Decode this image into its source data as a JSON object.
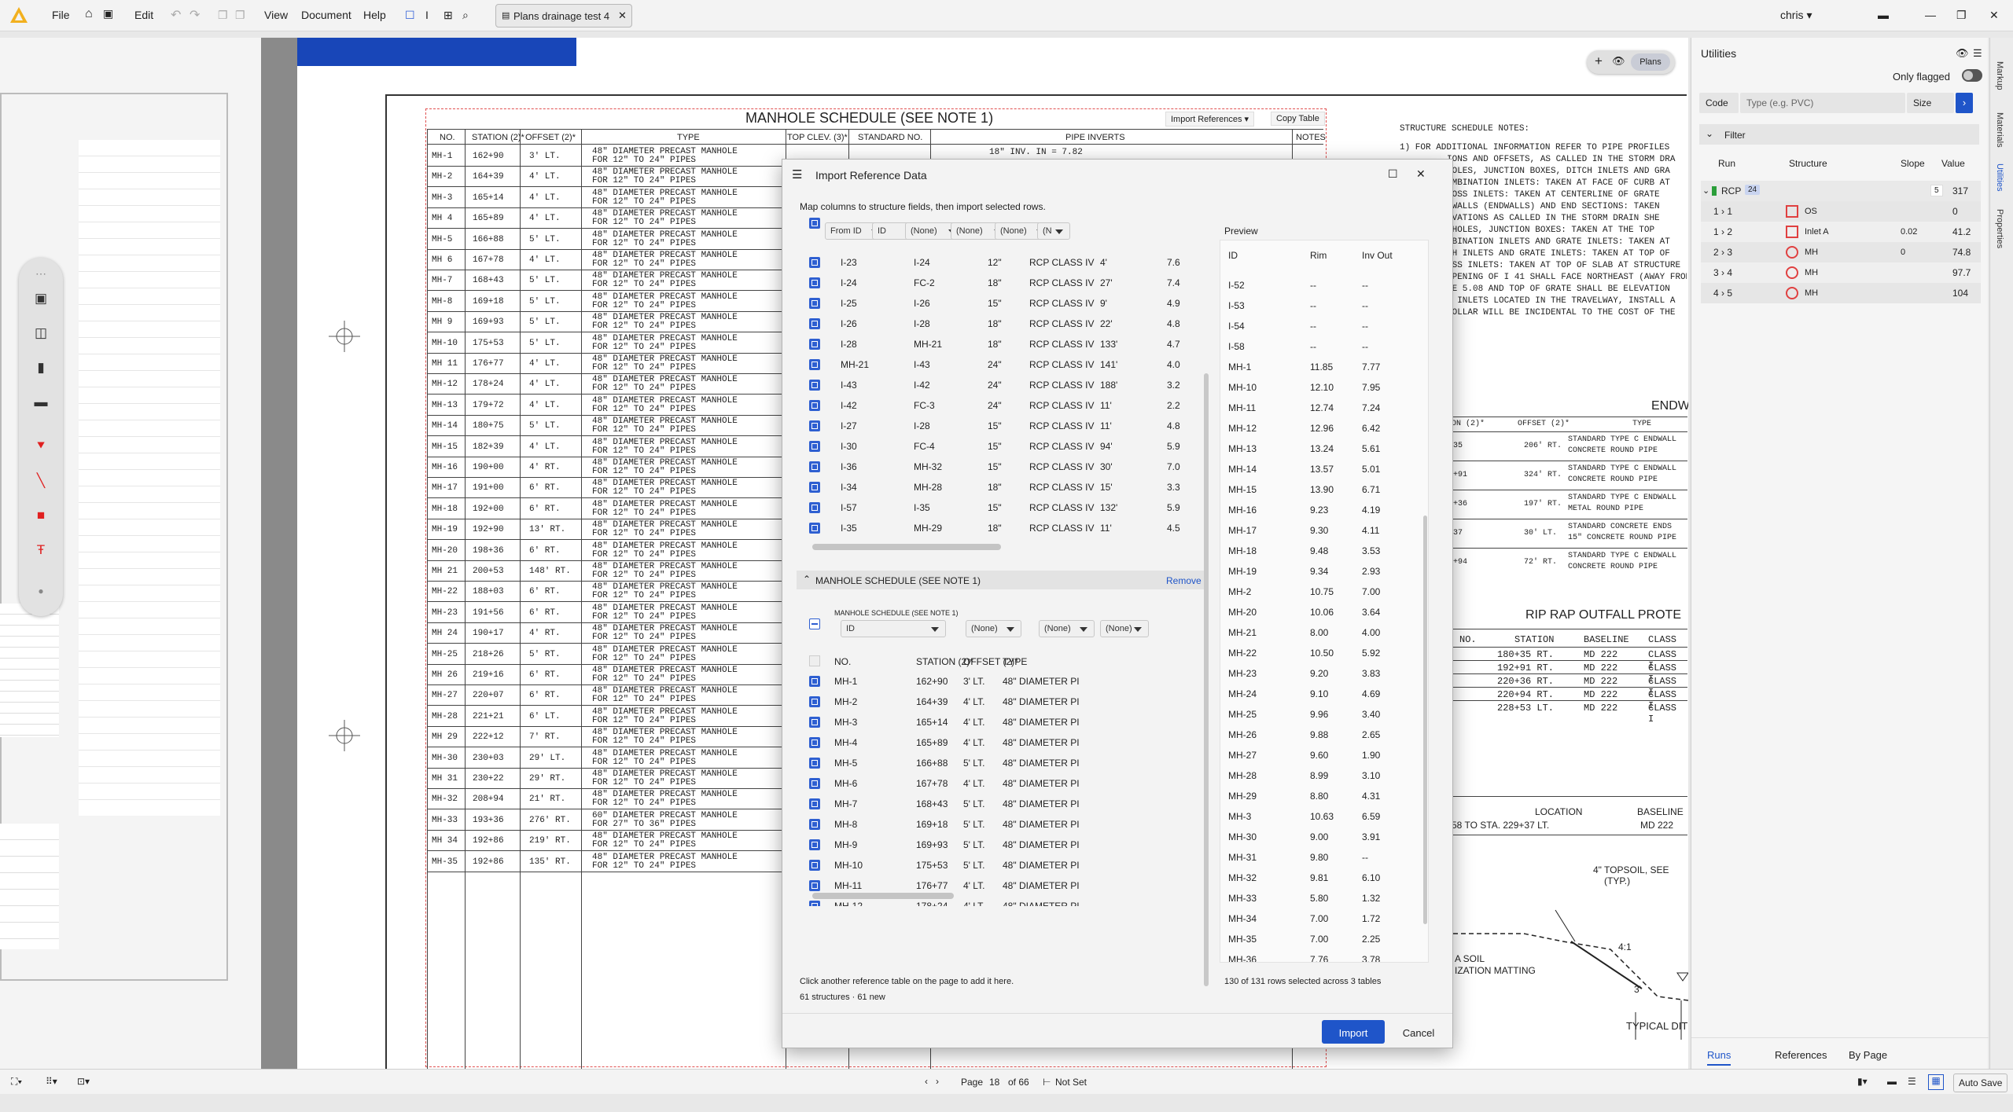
{
  "menu": {
    "file": "File",
    "edit": "Edit",
    "view": "View",
    "document": "Document",
    "help": "Help",
    "user": "chris"
  },
  "doc_tab": {
    "title": "Plans drainage test 4"
  },
  "drawing": {
    "schedule_title": "MANHOLE SCHEDULE  (SEE NOTE 1)",
    "import_refs": "Import References",
    "copy_table": "Copy Table",
    "col_no": "NO.",
    "col_station": "STATION (2)*",
    "col_offset": "OFFSET (2)*",
    "col_type": "TYPE",
    "col_top": "TOP CLEV. (3)*",
    "col_std": "STANDARD NO.",
    "col_pipe": "PIPE INVERTS",
    "col_notes": "NOTES",
    "pipe_row1": "18\" INV. IN = 7.82",
    "view_badge": "Plans",
    "rows": [
      {
        "no": "MH-1",
        "sta": "162+90",
        "off": "3' LT.",
        "t1": "48\" DIAMETER PRECAST MANHOLE",
        "t2": "FOR 12\" TO 24\" PIPES"
      },
      {
        "no": "MH-2",
        "sta": "164+39",
        "off": "4' LT.",
        "t1": "48\" DIAMETER PRECAST MANHOLE",
        "t2": "FOR 12\" TO 24\" PIPES"
      },
      {
        "no": "MH-3",
        "sta": "165+14",
        "off": "4' LT.",
        "t1": "48\" DIAMETER PRECAST MANHOLE",
        "t2": "FOR 12\" TO 24\" PIPES"
      },
      {
        "no": "MH 4",
        "sta": "165+89",
        "off": "4' LT.",
        "t1": "48\" DIAMETER PRECAST MANHOLE",
        "t2": "FOR 12\" TO 24\" PIPES"
      },
      {
        "no": "MH-5",
        "sta": "166+88",
        "off": "5' LT.",
        "t1": "48\" DIAMETER PRECAST MANHOLE",
        "t2": "FOR 12\" TO 24\" PIPES"
      },
      {
        "no": "MH 6",
        "sta": "167+78",
        "off": "4' LT.",
        "t1": "48\" DIAMETER PRECAST MANHOLE",
        "t2": "FOR 12\" TO 24\" PIPES"
      },
      {
        "no": "MH-7",
        "sta": "168+43",
        "off": "5' LT.",
        "t1": "48\" DIAMETER PRECAST MANHOLE",
        "t2": "FOR 12\" TO 24\" PIPES"
      },
      {
        "no": "MH-8",
        "sta": "169+18",
        "off": "5' LT.",
        "t1": "48\" DIAMETER PRECAST MANHOLE",
        "t2": "FOR 12\" TO 24\" PIPES"
      },
      {
        "no": "MH 9",
        "sta": "169+93",
        "off": "5' LT.",
        "t1": "48\" DIAMETER PRECAST MANHOLE",
        "t2": "FOR 12\" TO 24\" PIPES"
      },
      {
        "no": "MH-10",
        "sta": "175+53",
        "off": "5' LT.",
        "t1": "48\" DIAMETER PRECAST MANHOLE",
        "t2": "FOR 12\" TO 24\" PIPES"
      },
      {
        "no": "MH 11",
        "sta": "176+77",
        "off": "4' LT.",
        "t1": "48\" DIAMETER PRECAST MANHOLE",
        "t2": "FOR 12\" TO 24\" PIPES"
      },
      {
        "no": "MH-12",
        "sta": "178+24",
        "off": "4' LT.",
        "t1": "48\" DIAMETER PRECAST MANHOLE",
        "t2": "FOR 12\" TO 24\" PIPES"
      },
      {
        "no": "MH-13",
        "sta": "179+72",
        "off": "4' LT.",
        "t1": "48\" DIAMETER PRECAST MANHOLE",
        "t2": "FOR 12\" TO 24\" PIPES"
      },
      {
        "no": "MH-14",
        "sta": "180+75",
        "off": "5' LT.",
        "t1": "48\" DIAMETER PRECAST MANHOLE",
        "t2": "FOR 12\" TO 24\" PIPES"
      },
      {
        "no": "MH-15",
        "sta": "182+39",
        "off": "4' LT.",
        "t1": "48\" DIAMETER PRECAST MANHOLE",
        "t2": "FOR 12\" TO 24\" PIPES"
      },
      {
        "no": "MH-16",
        "sta": "190+00",
        "off": "4' RT.",
        "t1": "48\" DIAMETER PRECAST MANHOLE",
        "t2": "FOR 12\" TO 24\" PIPES"
      },
      {
        "no": "MH-17",
        "sta": "191+00",
        "off": "6' RT.",
        "t1": "48\" DIAMETER PRECAST MANHOLE",
        "t2": "FOR 12\" TO 24\" PIPES"
      },
      {
        "no": "MH-18",
        "sta": "192+00",
        "off": "6' RT.",
        "t1": "48\" DIAMETER PRECAST MANHOLE",
        "t2": "FOR 12\" TO 24\" PIPES"
      },
      {
        "no": "MH-19",
        "sta": "192+90",
        "off": "13' RT.",
        "t1": "48\" DIAMETER PRECAST MANHOLE",
        "t2": "FOR 12\" TO 24\" PIPES"
      },
      {
        "no": "MH-20",
        "sta": "198+36",
        "off": "6' RT.",
        "t1": "48\" DIAMETER PRECAST MANHOLE",
        "t2": "FOR 12\" TO 24\" PIPES"
      },
      {
        "no": "MH 21",
        "sta": "200+53",
        "off": "148' RT.",
        "t1": "48\" DIAMETER PRECAST MANHOLE",
        "t2": "FOR 12\" TO 24\" PIPES"
      },
      {
        "no": "MH-22",
        "sta": "188+03",
        "off": "6' RT.",
        "t1": "48\" DIAMETER PRECAST MANHOLE",
        "t2": "FOR 12\" TO 24\" PIPES"
      },
      {
        "no": "MH-23",
        "sta": "191+56",
        "off": "6' RT.",
        "t1": "48\" DIAMETER PRECAST MANHOLE",
        "t2": "FOR 12\" TO 24\" PIPES"
      },
      {
        "no": "MH 24",
        "sta": "190+17",
        "off": "4' RT.",
        "t1": "48\" DIAMETER PRECAST MANHOLE",
        "t2": "FOR 12\" TO 24\" PIPES"
      },
      {
        "no": "MH-25",
        "sta": "218+26",
        "off": "5' RT.",
        "t1": "48\" DIAMETER PRECAST MANHOLE",
        "t2": "FOR 12\" TO 24\" PIPES"
      },
      {
        "no": "MH 26",
        "sta": "219+16",
        "off": "6' RT.",
        "t1": "48\" DIAMETER PRECAST MANHOLE",
        "t2": "FOR 12\" TO 24\" PIPES"
      },
      {
        "no": "MH-27",
        "sta": "220+07",
        "off": "6' RT.",
        "t1": "48\" DIAMETER PRECAST MANHOLE",
        "t2": "FOR 12\" TO 24\" PIPES"
      },
      {
        "no": "MH-28",
        "sta": "221+21",
        "off": "6' LT.",
        "t1": "48\" DIAMETER PRECAST MANHOLE",
        "t2": "FOR 12\" TO 24\" PIPES"
      },
      {
        "no": "MH 29",
        "sta": "222+12",
        "off": "7' RT.",
        "t1": "48\" DIAMETER PRECAST MANHOLE",
        "t2": "FOR 12\" TO 24\" PIPES"
      },
      {
        "no": "MH-30",
        "sta": "230+03",
        "off": "29' LT.",
        "t1": "48\" DIAMETER PRECAST MANHOLE",
        "t2": "FOR 12\" TO 24\" PIPES"
      },
      {
        "no": "MH 31",
        "sta": "230+22",
        "off": "29' RT.",
        "t1": "48\" DIAMETER PRECAST MANHOLE",
        "t2": "FOR 12\" TO 24\" PIPES"
      },
      {
        "no": "MH-32",
        "sta": "208+94",
        "off": "21' RT.",
        "t1": "48\" DIAMETER PRECAST MANHOLE",
        "t2": "FOR 12\" TO 24\" PIPES"
      },
      {
        "no": "MH-33",
        "sta": "193+36",
        "off": "276' RT.",
        "t1": "60\" DIAMETER PRECAST MANHOLE",
        "t2": "FOR 27\" TO 36\" PIPES"
      },
      {
        "no": "MH 34",
        "sta": "192+86",
        "off": "219' RT.",
        "t1": "48\" DIAMETER PRECAST MANHOLE",
        "t2": "FOR 12\" TO 24\" PIPES"
      },
      {
        "no": "MH-35",
        "sta": "192+86",
        "off": "135' RT.",
        "t1": "48\" DIAMETER PRECAST MANHOLE",
        "t2": "FOR 12\" TO 24\" PIPES"
      }
    ],
    "notes_title": "STRUCTURE SCHEDULE NOTES:",
    "notes": [
      "1)  FOR ADDITIONAL INFORMATION REFER TO PIPE PROFILES",
      "IONS AND OFFSETS, AS CALLED IN THE STORM DRA",
      "HOLES, JUNCTION BOXES, DITCH INLETS AND GRA",
      "OMBINATION INLETS: TAKEN AT FACE OF CURB AT",
      "ROSS INLETS: TAKEN AT CENTERLINE OF GRATE",
      "DWALLS (ENDWALLS) AND END SECTIONS: TAKEN",
      "EVATIONS AS CALLED IN THE STORM DRAIN SHE",
      "NHOLES, JUNCTION BOXES: TAKEN AT THE TOP",
      "MBINATION INLETS AND GRATE INLETS: TAKEN AT",
      "CH INLETS AND GRATE INLETS: TAKEN AT TOP OF",
      "OSS INLETS: TAKEN AT TOP OF SLAB AT STRUCTURE",
      "OPENING OF I 41 SHALL FACE NORTHEAST (AWAY FROM",
      "BE 5.08 AND TOP OF GRATE SHALL BE ELEVATION",
      "L INLETS LOCATED IN THE TRAVELWAY, INSTALL A",
      "COLLAR WILL BE INCIDENTAL TO THE COST OF THE"
    ],
    "endw_title": "ENDW",
    "endw_col1": "ON (2)*",
    "endw_col2": "OFFSET (2)*",
    "endw_col3": "TYPE",
    "endw_rows": [
      {
        "a": "35",
        "b": "206' RT.",
        "c1": "STANDARD TYPE C ENDWALL",
        "c2": "CONCRETE ROUND PIPE"
      },
      {
        "a": "+91",
        "b": "324' RT.",
        "c1": "STANDARD TYPE C ENDWALL",
        "c2": "CONCRETE ROUND PIPE"
      },
      {
        "a": "+36",
        "b": "197' RT.",
        "c1": "STANDARD TYPE C ENDWALL",
        "c2": "METAL ROUND PIPE"
      },
      {
        "a": "37",
        "b": "30' LT.",
        "c1": "STANDARD CONCRETE ENDS",
        "c2": "15\" CONCRETE ROUND PIPE"
      },
      {
        "a": "+94",
        "b": "72' RT.",
        "c1": "STANDARD TYPE C ENDWALL",
        "c2": "CONCRETE ROUND PIPE"
      }
    ],
    "riprap_title": "RIP RAP OUTFALL PROTE",
    "riprap_cols": [
      "NO.",
      "STATION",
      "BASELINE",
      "CLASS"
    ],
    "riprap_rows": [
      [
        "",
        "180+35 RT.",
        "MD 222",
        "CLASS I"
      ],
      [
        "",
        "192+91 RT.",
        "MD 222",
        "CLASS I"
      ],
      [
        "",
        "220+36 RT.",
        "MD 222",
        "CLASS I"
      ],
      [
        "",
        "220+94 RT.",
        "MD 222",
        "CLASS I"
      ],
      [
        "",
        "228+53 LT.",
        "MD 222",
        "CLASS I"
      ]
    ],
    "loc_label": "LOCATION",
    "base_label": "BASELINE",
    "loc_val": "58 TO STA. 229+37 LT.",
    "base_val": "MD 222",
    "topsoil": "4\" TOPSOIL, SEE",
    "typ": "(TYP.)",
    "soil": "A SOIL",
    "matting": "IZATION MATTING",
    "slope": "4:1",
    "dim": "3'",
    "typical": "TYPICAL DIT"
  },
  "dialog": {
    "title": "Import Reference Data",
    "instruction": "Map columns to structure fields, then import selected rows.",
    "t1_selects": [
      "From ID",
      "ID",
      "(None)",
      "(None)",
      "(None)",
      "(N"
    ],
    "t1_rows": [
      [
        "I-23",
        "I-24",
        "12\"",
        "RCP CLASS IV",
        "4'",
        "7.6"
      ],
      [
        "I-24",
        "FC-2",
        "18\"",
        "RCP CLASS IV",
        "27'",
        "7.4"
      ],
      [
        "I-25",
        "I-26",
        "15\"",
        "RCP CLASS IV",
        "9'",
        "4.9"
      ],
      [
        "I-26",
        "I-28",
        "18\"",
        "RCP CLASS IV",
        "22'",
        "4.8"
      ],
      [
        "I-28",
        "MH-21",
        "18\"",
        "RCP CLASS IV",
        "133'",
        "4.7"
      ],
      [
        "MH-21",
        "I-43",
        "24\"",
        "RCP CLASS IV",
        "141'",
        "4.0"
      ],
      [
        "I-43",
        "I-42",
        "24\"",
        "RCP CLASS IV",
        "188'",
        "3.2"
      ],
      [
        "I-42",
        "FC-3",
        "24\"",
        "RCP CLASS IV",
        "11'",
        "2.2"
      ],
      [
        "I-27",
        "I-28",
        "15\"",
        "RCP CLASS IV",
        "11'",
        "4.8"
      ],
      [
        "I-30",
        "FC-4",
        "15\"",
        "RCP CLASS IV",
        "94'",
        "5.9"
      ],
      [
        "I-36",
        "MH-32",
        "15\"",
        "RCP CLASS IV",
        "30'",
        "7.0"
      ],
      [
        "I-34",
        "MH-28",
        "18\"",
        "RCP CLASS IV",
        "15'",
        "3.3"
      ],
      [
        "I-57",
        "I-35",
        "15\"",
        "RCP CLASS IV",
        "132'",
        "5.9"
      ],
      [
        "I-35",
        "MH-29",
        "18\"",
        "RCP CLASS IV",
        "11'",
        "4.5"
      ]
    ],
    "t2_title": "MANHOLE SCHEDULE (SEE NOTE 1)",
    "t2_remove": "Remove",
    "t2_small": "MANHOLE SCHEDULE (SEE NOTE 1)",
    "t2_selects": [
      "ID",
      "(None)",
      "(None)",
      "(None)"
    ],
    "t2_headers": [
      "NO.",
      "STATION (2)*",
      "OFFSET (2)*",
      "TYPE"
    ],
    "t2_rows": [
      [
        "MH-1",
        "162+90",
        "3' LT.",
        "48\" DIAMETER PI"
      ],
      [
        "MH-2",
        "164+39",
        "4' LT.",
        "48\" DIAMETER PI"
      ],
      [
        "MH-3",
        "165+14",
        "4' LT.",
        "48\" DIAMETER PI"
      ],
      [
        "MH-4",
        "165+89",
        "4' LT.",
        "48\" DIAMETER PI"
      ],
      [
        "MH-5",
        "166+88",
        "5' LT.",
        "48\" DIAMETER PI"
      ],
      [
        "MH-6",
        "167+78",
        "4' LT.",
        "48\" DIAMETER PI"
      ],
      [
        "MH-7",
        "168+43",
        "5' LT.",
        "48\" DIAMETER PI"
      ],
      [
        "MH-8",
        "169+18",
        "5' LT.",
        "48\" DIAMETER PI"
      ],
      [
        "MH-9",
        "169+93",
        "5' LT.",
        "48\" DIAMETER PI"
      ],
      [
        "MH-10",
        "175+53",
        "5' LT.",
        "48\" DIAMETER PI"
      ],
      [
        "MH-11",
        "176+77",
        "4' LT.",
        "48\" DIAMETER PI"
      ],
      [
        "MH-12",
        "178+24",
        "4' LT.",
        "48\" DIAMETER PI"
      ],
      [
        "MH-13",
        "179+72",
        "4' LT.",
        "48\" DIAMETER PI"
      ]
    ],
    "hint": "Click another reference table on the page to add it here.",
    "count": "61 structures · 61 new",
    "preview_title": "Preview",
    "preview_headers": [
      "ID",
      "Rim",
      "Inv Out"
    ],
    "preview_rows": [
      [
        "I-52",
        "--",
        "--"
      ],
      [
        "I-53",
        "--",
        "--"
      ],
      [
        "I-54",
        "--",
        "--"
      ],
      [
        "I-58",
        "--",
        "--"
      ],
      [
        "MH-1",
        "11.85",
        "7.77"
      ],
      [
        "MH-10",
        "12.10",
        "7.95"
      ],
      [
        "MH-11",
        "12.74",
        "7.24"
      ],
      [
        "MH-12",
        "12.96",
        "6.42"
      ],
      [
        "MH-13",
        "13.24",
        "5.61"
      ],
      [
        "MH-14",
        "13.57",
        "5.01"
      ],
      [
        "MH-15",
        "13.90",
        "6.71"
      ],
      [
        "MH-16",
        "9.23",
        "4.19"
      ],
      [
        "MH-17",
        "9.30",
        "4.11"
      ],
      [
        "MH-18",
        "9.48",
        "3.53"
      ],
      [
        "MH-19",
        "9.34",
        "2.93"
      ],
      [
        "MH-2",
        "10.75",
        "7.00"
      ],
      [
        "MH-20",
        "10.06",
        "3.64"
      ],
      [
        "MH-21",
        "8.00",
        "4.00"
      ],
      [
        "MH-22",
        "10.50",
        "5.92"
      ],
      [
        "MH-23",
        "9.20",
        "3.83"
      ],
      [
        "MH-24",
        "9.10",
        "4.69"
      ],
      [
        "MH-25",
        "9.96",
        "3.40"
      ],
      [
        "MH-26",
        "9.88",
        "2.65"
      ],
      [
        "MH-27",
        "9.60",
        "1.90"
      ],
      [
        "MH-28",
        "8.99",
        "3.10"
      ],
      [
        "MH-29",
        "8.80",
        "4.31"
      ],
      [
        "MH-3",
        "10.63",
        "6.59"
      ],
      [
        "MH-30",
        "9.00",
        "3.91"
      ],
      [
        "MH-31",
        "9.80",
        "--"
      ],
      [
        "MH-32",
        "9.81",
        "6.10"
      ],
      [
        "MH-33",
        "5.80",
        "1.32"
      ],
      [
        "MH-34",
        "7.00",
        "1.72"
      ],
      [
        "MH-35",
        "7.00",
        "2.25"
      ],
      [
        "MH-36",
        "7.76",
        "3.78"
      ]
    ],
    "preview_footer": "130 of 131 rows selected across 3 tables",
    "import_btn": "Import",
    "cancel_btn": "Cancel"
  },
  "utilities": {
    "title": "Utilities",
    "only_flagged": "Only flagged",
    "code_label": "Code",
    "type_placeholder": "Type (e.g. PVC)",
    "size_label": "Size",
    "filter_label": "Filter",
    "col_run": "Run",
    "col_structure": "Structure",
    "col_slope": "Slope",
    "col_value": "Value",
    "group_name": "RCP",
    "group_count": "24",
    "group_small": "5",
    "group_value": "317",
    "rows": [
      {
        "run": "1 › 1",
        "structure": "OS",
        "slope": "",
        "value": "0"
      },
      {
        "run": "1 › 2",
        "structure": "Inlet A",
        "slope": "0.02",
        "value": "41.2"
      },
      {
        "run": "2 › 3",
        "structure": "MH",
        "slope": "0",
        "value": "74.8"
      },
      {
        "run": "3 › 4",
        "structure": "MH",
        "slope": "",
        "value": "97.7"
      },
      {
        "run": "4 › 5",
        "structure": "MH",
        "slope": "",
        "value": "104"
      }
    ],
    "tabs": [
      "Runs",
      "References",
      "By Page"
    ]
  },
  "side_tabs": [
    "Markup",
    "Materials",
    "Utilities",
    "Properties"
  ],
  "status": {
    "page_label": "Page",
    "page_num": "18",
    "page_of": "of 66",
    "not_set": "Not Set",
    "auto_save": "Auto Save"
  }
}
